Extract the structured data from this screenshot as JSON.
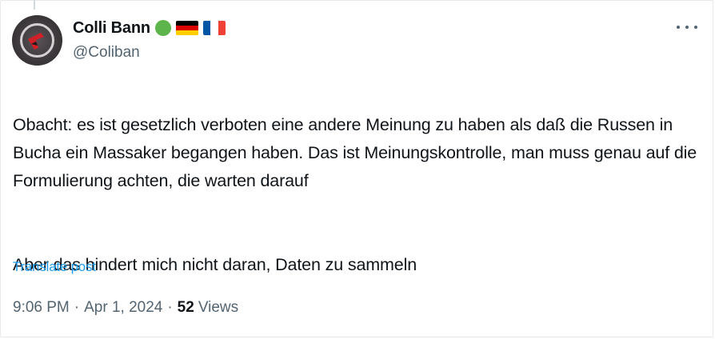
{
  "author": {
    "display_name": "Colli Bann",
    "handle": "@Coliban",
    "badges": [
      "green-circle-icon",
      "germany-flag-icon",
      "france-flag-icon"
    ]
  },
  "post": {
    "paragraphs": [
      "Obacht: es ist gesetzlich verboten eine andere Meinung zu haben als daß die Russen in Bucha ein Massaker begangen haben. Das ist Meinungskontrolle, man muss genau auf die Formulierung achten, die warten darauf",
      "Aber das hindert mich nicht daran, Daten zu sammeln"
    ],
    "translate_label": "Translate post",
    "time": "9:06 PM",
    "date": "Apr 1, 2024",
    "separator": "·",
    "views_count": "52",
    "views_label": "Views"
  },
  "colors": {
    "link": "#1d9bf0",
    "secondary_text": "#536471",
    "primary_text": "#0f1419"
  }
}
